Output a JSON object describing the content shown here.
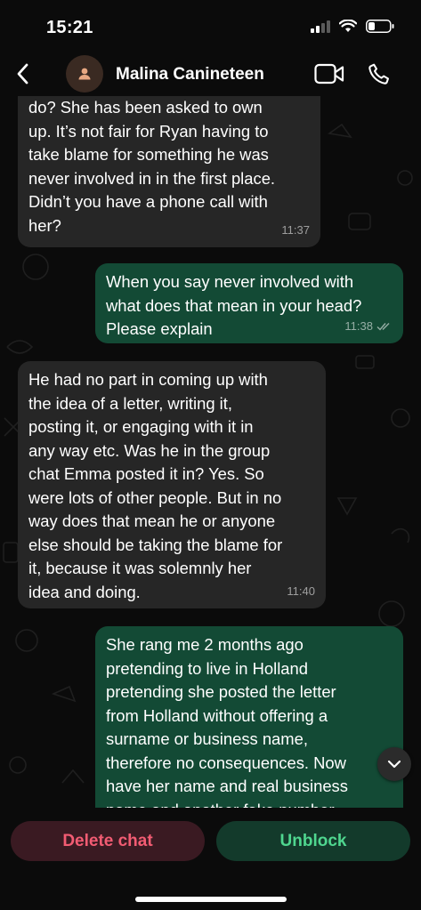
{
  "status_bar": {
    "time": "15:21"
  },
  "header": {
    "contact_name": "Malina Canineteen"
  },
  "messages": [
    {
      "direction": "incoming",
      "text": "do? She has been asked to own\nup. It’s not fair for Ryan having to\ntake blame for something he was\nnever involved in in the first place.\nDidn’t you have a phone call with\nher?",
      "time": "11:37"
    },
    {
      "direction": "outgoing",
      "text": "When you say never involved with\nwhat does that mean in your head?\nPlease explain",
      "time": "11:38",
      "status": "read-double-check"
    },
    {
      "direction": "incoming",
      "text": "He had no part in coming up with\nthe idea of a letter, writing it,\nposting it, or engaging with it in\nany way etc. Was he in the group\nchat Emma posted it in? Yes. So\nwere lots of other people. But in no\nway does that mean he or anyone\nelse should be taking the blame for\nit, because it was solemnly her\nidea and doing.",
      "time": "11:40"
    },
    {
      "direction": "outgoing",
      "text": "She rang me 2 months ago\npretending to live in Holland\npretending she posted the letter\nfrom Holland without offering a\nsurname or business name,\ntherefore no consequences. Now\nhave her name and real business\nname and another fake number"
    }
  ],
  "actions": {
    "delete_label": "Delete chat",
    "unblock_label": "Unblock"
  },
  "colors": {
    "incoming_bubble": "#262626",
    "outgoing_bubble": "#134a35",
    "delete": "#f25c73",
    "unblock": "#4fd68f"
  }
}
